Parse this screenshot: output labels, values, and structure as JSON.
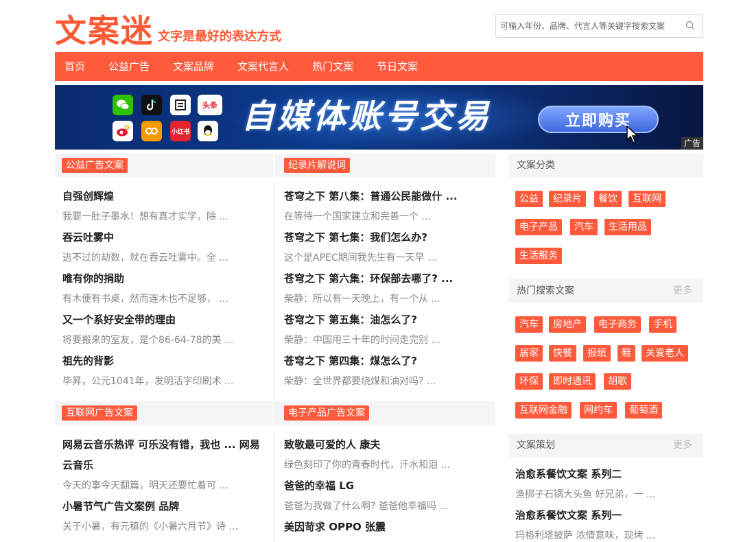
{
  "header": {
    "logo": "文案迷",
    "slogan": "文字是最好的表达方式",
    "search_placeholder": "可输入年份、品牌、代言人等关键字搜索文案"
  },
  "nav": [
    "首页",
    "公益广告",
    "文案品牌",
    "文案代言人",
    "热门文案",
    "节日文案"
  ],
  "banner": {
    "apps": [
      "头条",
      "小红书"
    ],
    "title": "自媒体账号交易",
    "button": "立即购买",
    "ad_tag": "广告"
  },
  "sections": {
    "gongyi": {
      "title": "公益广告文案",
      "articles": [
        {
          "title": "自强创辉煌",
          "desc": "我要一肚子墨水！想有真才实学，除 ..."
        },
        {
          "title": "吞云吐雾中",
          "desc": "逃不过的劫数，就在吞云吐雾中。全 ..."
        },
        {
          "title": "唯有你的捐助",
          "desc": "有木便有书桌，然而连木也不足够，  ..."
        },
        {
          "title": "又一个系好安全带的理由",
          "desc": "将要搬来的室友，是个86-64-78的美 ..."
        },
        {
          "title": "祖先的背影",
          "desc": "毕昇，公元1041年，发明活字印刷术 ..."
        }
      ]
    },
    "jilupian": {
      "title": "纪录片解说词",
      "articles": [
        {
          "title": "苍穹之下 第八集：普通公民能做什 ...",
          "desc": "在等待一个国家建立和完善一个  ..."
        },
        {
          "title": "苍穹之下 第七集：我们怎么办?",
          "desc": "这个是APEC期间我先生有一天早 ..."
        },
        {
          "title": "苍穹之下 第六集：环保部去哪了?  ...",
          "desc": "柴静：所以有一天晚上，有一个从  ..."
        },
        {
          "title": "苍穹之下 第五集：油怎么了?",
          "desc": "柴静：中国用三十年的时间走完别  ..."
        },
        {
          "title": "苍穹之下 第四集：煤怎么了?",
          "desc": "柴静：全世界都要烧煤和油对吗?  ..."
        }
      ]
    },
    "hulianwang": {
      "title": "互联网广告文案",
      "articles": [
        {
          "title": "网易云音乐热评 可乐没有错，我也 ... 网易",
          "title2": "云音乐",
          "desc": "今天的事今天翻篇，明天还要忙着可 ..."
        },
        {
          "title": "小暑节气广告文案例 品牌",
          "desc": "关于小暑，有元稹的《小暑六月节》诗 ..."
        }
      ]
    },
    "dianzi": {
      "title": "电子产品广告文案",
      "articles": [
        {
          "title": "致敬最可爱的人 康夫",
          "desc": "绿色刻印了你的青春时代，汗水和泪 ..."
        },
        {
          "title": "爸爸的幸福 LG",
          "desc": "爸爸为我做了什么啊? 爸爸他幸福吗 ..."
        },
        {
          "title": "美因苛求 OPPO 张震",
          "desc": ""
        }
      ]
    }
  },
  "sidebar": {
    "categories": {
      "title": "文案分类",
      "tags": [
        "公益",
        "纪录片",
        "餐饮",
        "互联网",
        "电子产品",
        "汽车",
        "生活用品",
        "生活服务"
      ]
    },
    "hot": {
      "title": "热门搜索文案",
      "more": "更多",
      "tags": [
        "汽车",
        "房地产",
        "电子商务",
        "手机",
        "居家",
        "快餐",
        "报纸",
        "鞋",
        "关爱老人",
        "环保",
        "即时通讯",
        "胡歌",
        "互联网金融",
        "网约车",
        "葡萄酒"
      ]
    },
    "planning": {
      "title": "文案策划",
      "more": "更多",
      "articles": [
        {
          "title": "治愈系餐饮文案 系列二",
          "desc": "渔梆子石锅大头鱼 好兄弟，一 ..."
        },
        {
          "title": "治愈系餐饮文案 系列一",
          "desc": "玛格利塔披萨 浓情意味，现烤 ..."
        }
      ]
    }
  },
  "colors": {
    "accent": "#ff5a3c",
    "banner_bg": "#0b3a8c"
  }
}
